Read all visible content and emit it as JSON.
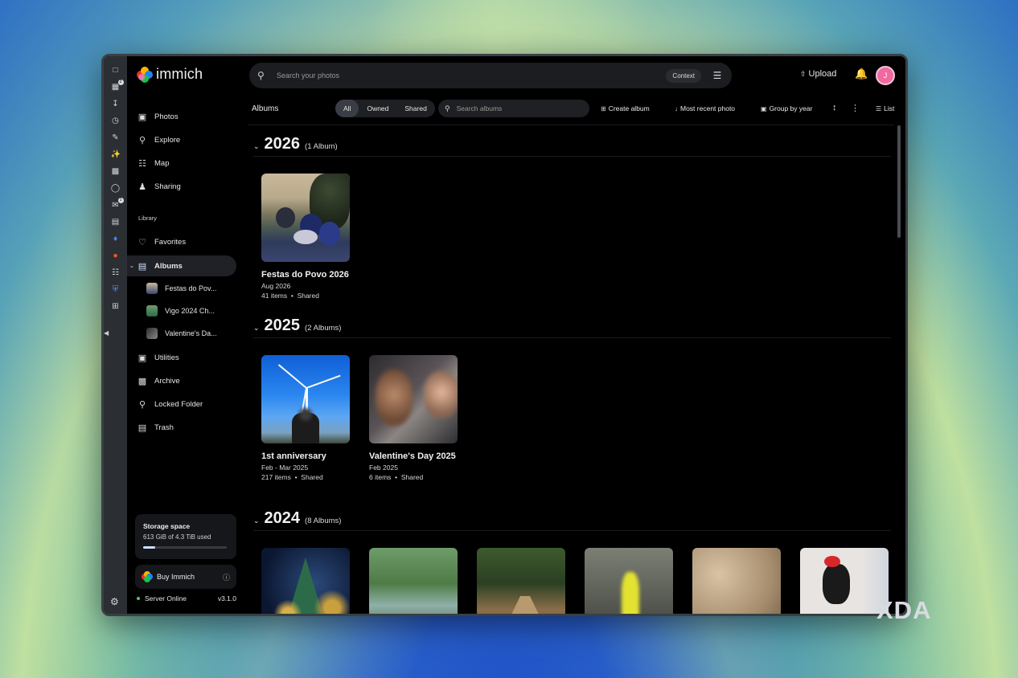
{
  "app": {
    "name": "immich"
  },
  "header": {
    "search_placeholder": "Search your photos",
    "context_chip": "Context",
    "upload_label": "Upload",
    "avatar_initial": "J"
  },
  "sidebar": {
    "items": [
      {
        "label": "Photos",
        "icon": "photos-icon"
      },
      {
        "label": "Explore",
        "icon": "search-icon"
      },
      {
        "label": "Map",
        "icon": "map-icon"
      },
      {
        "label": "Sharing",
        "icon": "people-icon"
      }
    ],
    "library_label": "Library",
    "library_items": [
      {
        "label": "Favorites",
        "icon": "heart-icon"
      },
      {
        "label": "Albums",
        "icon": "album-icon",
        "active": true
      }
    ],
    "album_sub_items": [
      {
        "label": "Festas do Pov..."
      },
      {
        "label": "Vigo 2024 Ch..."
      },
      {
        "label": "Valentine's Da..."
      }
    ],
    "bottom_items": [
      {
        "label": "Utilities",
        "icon": "toolbox-icon"
      },
      {
        "label": "Archive",
        "icon": "archive-icon"
      },
      {
        "label": "Locked Folder",
        "icon": "lock-icon"
      },
      {
        "label": "Trash",
        "icon": "trash-icon"
      }
    ],
    "storage": {
      "title": "Storage space",
      "used_text": "613 GiB of 4.3 TiB used",
      "used_fraction": 0.14
    },
    "buy_label": "Buy Immich",
    "server_status": "Server Online",
    "version": "v3.1.0"
  },
  "toolbar": {
    "title": "Albums",
    "filters": [
      "All",
      "Owned",
      "Shared"
    ],
    "active_filter": "All",
    "album_search_placeholder": "Search albums",
    "create_album": "Create album",
    "sort_label": "Most recent photo",
    "group_label": "Group by year",
    "view_label": "List"
  },
  "groups": [
    {
      "year": "2026",
      "count_label": "(1 Album)",
      "albums": [
        {
          "title": "Festas do Povo 2026",
          "date": "Aug 2026",
          "items": "41 items",
          "shared": "Shared"
        }
      ]
    },
    {
      "year": "2025",
      "count_label": "(2 Albums)",
      "albums": [
        {
          "title": "1st anniversary",
          "date": "Feb - Mar 2025",
          "items": "217 items",
          "shared": "Shared"
        },
        {
          "title": "Valentine's Day 2025",
          "date": "Feb 2025",
          "items": "6 items",
          "shared": "Shared"
        }
      ]
    },
    {
      "year": "2024",
      "count_label": "(8 Albums)",
      "albums": []
    }
  ],
  "watermark": "XDA"
}
